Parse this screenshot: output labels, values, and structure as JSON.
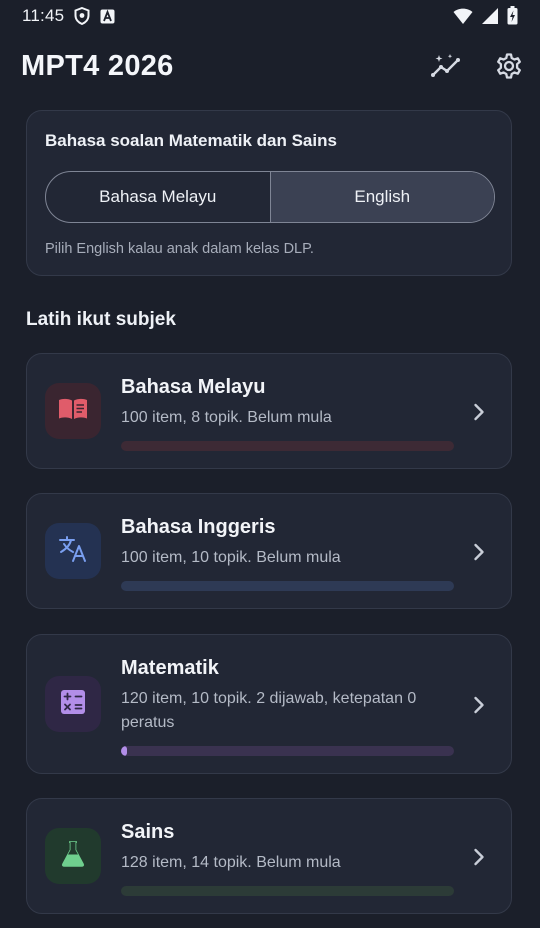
{
  "status_bar": {
    "time": "11:45",
    "left_icons": [
      "shield-icon",
      "app-notification-icon"
    ],
    "right_icons": [
      "wifi-icon",
      "signal-icon",
      "battery-charging-icon"
    ]
  },
  "app_bar": {
    "title": "MPT4 2026",
    "actions": [
      "stats-trend-icon",
      "gear-icon"
    ]
  },
  "language_card": {
    "title": "Bahasa soalan Matematik dan Sains",
    "options": [
      "Bahasa Melayu",
      "English"
    ],
    "selected": "English",
    "hint": "Pilih English kalau anak dalam kelas DLP."
  },
  "section_title": "Latih ikut subjek",
  "subjects": [
    {
      "name": "Bahasa Melayu",
      "description": "100 item, 8 topik. Belum mula",
      "icon": "book-icon",
      "accent": "#e05c6a",
      "tile_bg": "#3a2530",
      "track_color": "#3d2a35",
      "progress": 0
    },
    {
      "name": "Bahasa Inggeris",
      "description": "100 item, 10 topik. Belum mula",
      "icon": "translate-icon",
      "accent": "#7a9ff0",
      "tile_bg": "#243252",
      "track_color": "#2e3a55",
      "progress": 0
    },
    {
      "name": "Matematik",
      "description": "120 item, 10 topik. 2 dijawab, ketepatan 0 peratus",
      "icon": "calculator-icon",
      "accent": "#b28ee8",
      "tile_bg": "#2f2745",
      "track_color": "#3a3250",
      "progress": 0.017
    },
    {
      "name": "Sains",
      "description": "128 item, 14 topik. Belum mula",
      "icon": "flask-icon",
      "accent": "#6fcf8e",
      "tile_bg": "#213a2d",
      "track_color": "#2c3b37",
      "progress": 0
    }
  ]
}
